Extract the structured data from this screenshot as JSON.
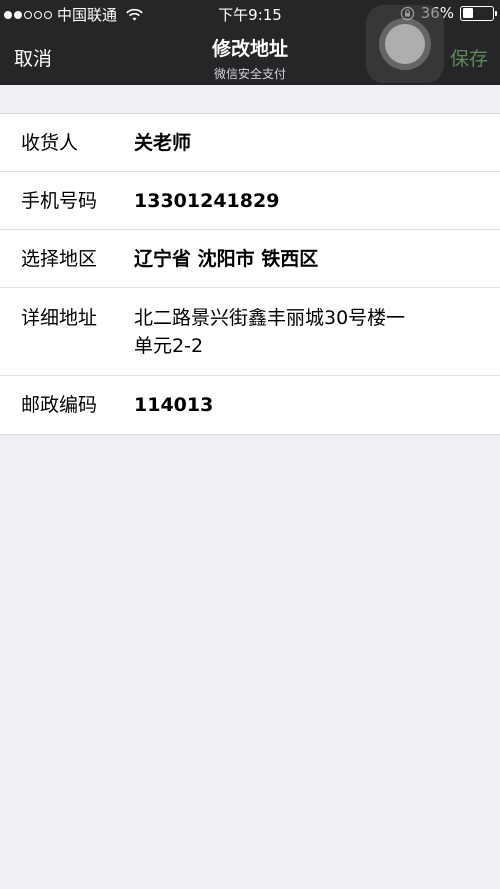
{
  "status_bar": {
    "carrier": "中国联通",
    "time": "下午9:15",
    "battery": "36%",
    "battery_level": 0.36
  },
  "nav": {
    "cancel_label": "取消",
    "title": "修改地址",
    "subtitle": "微信安全支付",
    "save_label": "保存"
  },
  "form": {
    "recipient": {
      "label": "收货人",
      "value": "关老师"
    },
    "phone": {
      "label": "手机号码",
      "value": "13301241829"
    },
    "region": {
      "label": "选择地区",
      "value": "辽宁省 沈阳市 铁西区"
    },
    "address": {
      "label": "详细地址",
      "value_line1": "北二路景兴街鑫丰丽城30号楼一",
      "value_line2": "单元2-2"
    },
    "postcode": {
      "label": "邮政编码",
      "value": "114013"
    }
  },
  "colors": {
    "nav_background": "#262629",
    "page_background": "#efeff4",
    "save_disabled": "#5c8a5c"
  }
}
